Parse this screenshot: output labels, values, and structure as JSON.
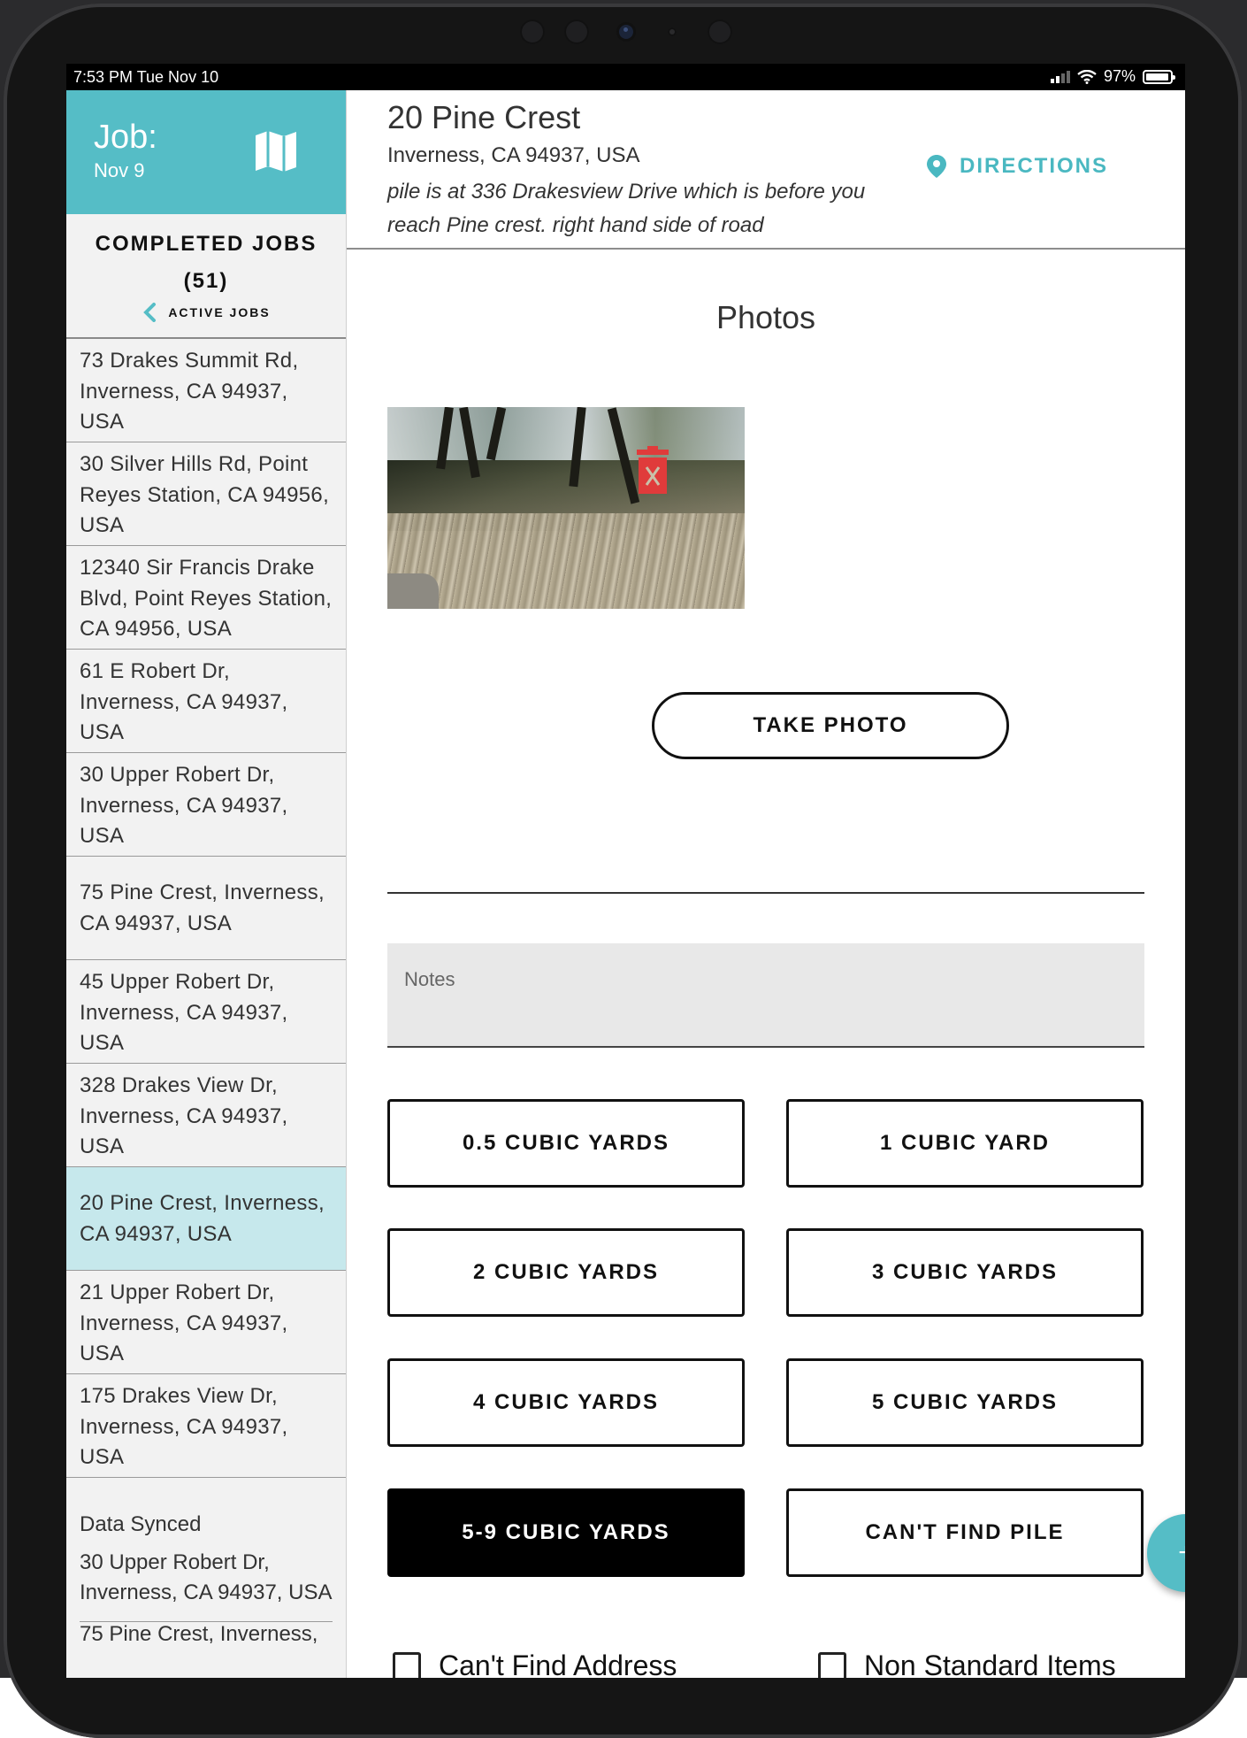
{
  "status_bar": {
    "time": "7:53 PM   Tue Nov 10",
    "battery": "97%"
  },
  "sidebar": {
    "job_label": "Job:",
    "job_date": "Nov 9",
    "completed_title": "COMPLETED JOBS",
    "completed_count": "(51)",
    "active_jobs_link": "ACTIVE JOBS",
    "jobs": [
      {
        "address": "73 Drakes Summit Rd, Inverness, CA 94937, USA"
      },
      {
        "address": "30 Silver Hills Rd, Point Reyes Station, CA 94956, USA"
      },
      {
        "address": "12340 Sir Francis Drake Blvd, Point Reyes Station, CA 94956, USA"
      },
      {
        "address": "61 E Robert Dr, Inverness, CA 94937, USA"
      },
      {
        "address": "30 Upper Robert Dr, Inverness, CA 94937, USA"
      },
      {
        "address": "75 Pine Crest, Inverness, CA 94937, USA"
      },
      {
        "address": "45 Upper Robert Dr, Inverness, CA 94937, USA"
      },
      {
        "address": "328 Drakes View Dr, Inverness, CA 94937, USA"
      },
      {
        "address": "20 Pine Crest, Inverness, CA 94937, USA",
        "selected": true
      },
      {
        "address": "21 Upper Robert Dr, Inverness, CA 94937, USA"
      },
      {
        "address": "175 Drakes View Dr, Inverness, CA 94937, USA"
      }
    ],
    "synced_label": "Data Synced",
    "synced_address": "30 Upper Robert Dr, Inverness, CA 94937, USA",
    "cutoff_text": "75 Pine Crest, Inverness,"
  },
  "main": {
    "address_title": "20 Pine Crest",
    "address_sub": "Inverness, CA 94937, USA",
    "note": "pile is at 336 Drakesview Drive which is before you reach Pine crest. right hand side of road",
    "directions_label": "DIRECTIONS",
    "photos_title": "Photos",
    "take_photo_label": "TAKE PHOTO",
    "notes_placeholder": "Notes",
    "volumes": [
      {
        "label": "0.5 CUBIC YARDS",
        "active": false
      },
      {
        "label": "1 CUBIC YARD",
        "active": false
      },
      {
        "label": "2 CUBIC YARDS",
        "active": false
      },
      {
        "label": "3 CUBIC YARDS",
        "active": false
      },
      {
        "label": "4 CUBIC YARDS",
        "active": false
      },
      {
        "label": "5 CUBIC YARDS",
        "active": false
      },
      {
        "label": "5-9 CUBIC YARDS",
        "active": true
      },
      {
        "label": "CAN'T FIND PILE",
        "active": false
      }
    ],
    "fab_label": "+",
    "checkbox_cant_find": "Can't Find Address",
    "checkbox_non_standard": "Non Standard Items"
  },
  "colors": {
    "accent": "#55bdc6",
    "selected_row": "#c6e8ec",
    "delete_icon": "#e03b3b"
  },
  "icons": {
    "map": "map-icon",
    "chevron": "chevron-left-icon",
    "pin": "location-pin-icon",
    "trash": "trash-icon"
  }
}
